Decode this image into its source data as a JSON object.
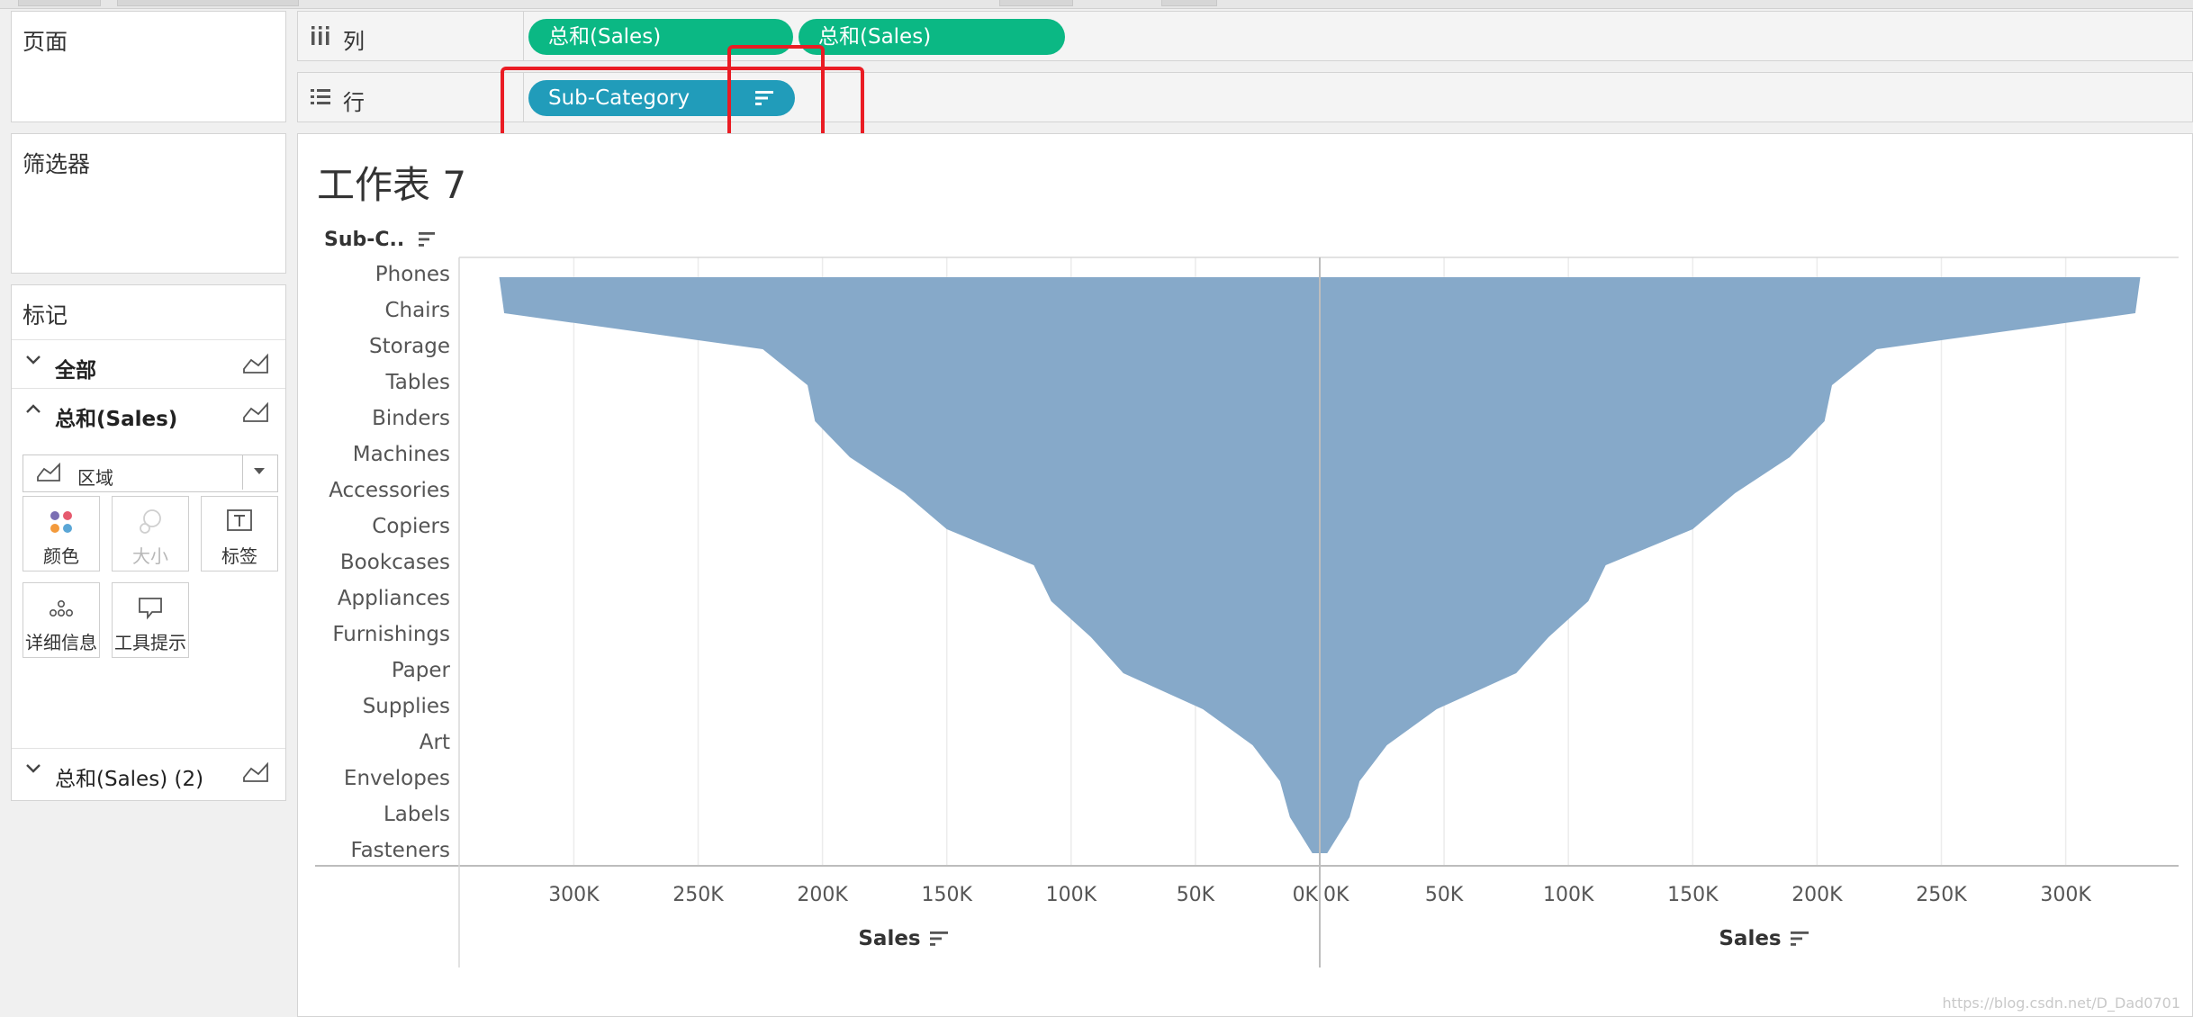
{
  "left_panel": {
    "pages_title": "页面",
    "filters_title": "筛选器",
    "marks": {
      "title": "标记",
      "rows": [
        {
          "label": "全部",
          "expanded": false
        },
        {
          "label": "总和(Sales)",
          "expanded": true
        },
        {
          "label": "总和(Sales) (2)",
          "expanded": false
        }
      ],
      "mark_type": "区域",
      "buttons": [
        {
          "label": "颜色",
          "icon": "color-icon",
          "enabled": true
        },
        {
          "label": "大小",
          "icon": "size-icon",
          "enabled": false
        },
        {
          "label": "标签",
          "icon": "label-icon",
          "enabled": true
        },
        {
          "label": "详细信息",
          "icon": "detail-icon",
          "enabled": true
        },
        {
          "label": "工具提示",
          "icon": "tooltip-icon",
          "enabled": true
        }
      ]
    }
  },
  "shelves": {
    "columns": {
      "name": "列",
      "icon": "columns-icon",
      "pills": [
        "总和(Sales)",
        "总和(Sales)"
      ]
    },
    "rows": {
      "name": "行",
      "icon": "rows-icon",
      "pills": [
        "Sub-Category"
      ]
    }
  },
  "sheet": {
    "title": "工作表 7",
    "row_header": "Sub-C..",
    "watermark": "https://blog.csdn.net/D_Dad0701"
  },
  "colors": {
    "area_fill": "#86a9c9",
    "pill_green": "#0bb884",
    "pill_blue": "#219cba",
    "highlight_red": "#ea1c24"
  },
  "chart_data": {
    "type": "area",
    "orientation": "horizontal mirrored (funnel)",
    "categories": [
      "Phones",
      "Chairs",
      "Storage",
      "Tables",
      "Binders",
      "Machines",
      "Accessories",
      "Copiers",
      "Bookcases",
      "Appliances",
      "Furnishings",
      "Paper",
      "Supplies",
      "Art",
      "Envelopes",
      "Labels",
      "Fasteners"
    ],
    "series": [
      {
        "values": [
          330000,
          328000,
          224000,
          206000,
          203000,
          189000,
          167000,
          150000,
          115000,
          108000,
          92000,
          79000,
          47000,
          27000,
          16000,
          12000,
          3000
        ]
      },
      {
        "values": [
          330000,
          328000,
          224000,
          206000,
          203000,
          189000,
          167000,
          150000,
          115000,
          108000,
          92000,
          79000,
          47000,
          27000,
          16000,
          12000,
          3000
        ]
      }
    ],
    "left_axis": {
      "title": "Sales",
      "ticks": [
        "300K",
        "250K",
        "200K",
        "150K",
        "100K",
        "50K",
        "0K"
      ],
      "reversed": true,
      "range": [
        0,
        330000
      ]
    },
    "right_axis": {
      "title": "Sales",
      "ticks": [
        "0K",
        "50K",
        "100K",
        "150K",
        "200K",
        "250K",
        "300K"
      ],
      "range": [
        0,
        330000
      ]
    },
    "grid": true
  }
}
